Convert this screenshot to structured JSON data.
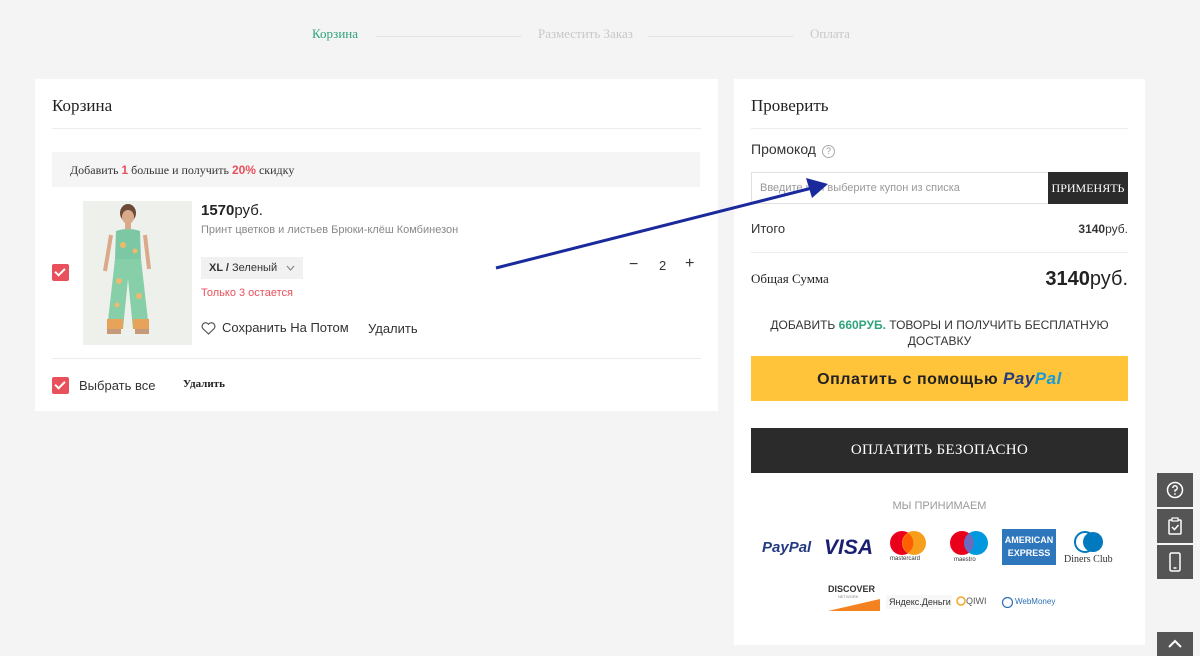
{
  "steps": {
    "cart": "Корзина",
    "place_order": "Разместить Заказ",
    "payment": "Оплата"
  },
  "cart": {
    "title": "Корзина",
    "promo_banner": {
      "prefix": "Добавить ",
      "count": "1",
      "middle": " больше и получить ",
      "discount": "20%",
      "suffix": " скидку"
    },
    "item": {
      "price": "1570",
      "currency": "руб.",
      "name": "Принт цветков и листьев Брюки-клёш Комбинезон",
      "variant_size": "XL",
      "variant_sep": " / ",
      "variant_color": "Зеленый",
      "stock": "Только 3 остается",
      "save_later": "Сохранить На Потом",
      "delete": "Удалить",
      "quantity": "2",
      "qty_minus": "−",
      "qty_plus": "+"
    },
    "select_all": "Выбрать все",
    "delete_all": "Удалить"
  },
  "checkout": {
    "title": "Проверить",
    "promo_label": "Промокод",
    "promo_help": "?",
    "promo_placeholder": "Введите или выберите купон из списка",
    "apply": "ПРИМЕНЯТЬ",
    "subtotal_label": "Итого",
    "subtotal_value": "3140",
    "subtotal_currency": "руб.",
    "total_label": "Общая Сумма",
    "total_value": "3140",
    "total_currency": "руб.",
    "free_ship": {
      "prefix": "ДОБАВИТЬ ",
      "amount": "660РУБ.",
      "suffix": " ТОВОРЫ И ПОЛУЧИТЬ БЕСПЛАТНУЮ ДОСТАВКУ"
    },
    "paypal_prefix": "Оплатить с помощью ",
    "paypal_pay": "Pay",
    "paypal_pal": "Pal",
    "secure": "ОПЛАТИТЬ БЕЗОПАСНО",
    "accept": "МЫ ПРИНИМАЕМ",
    "methods": {
      "paypal_pay": "PayPal",
      "visa": "VISA",
      "mastercard": "mastercard",
      "maestro": "maestro",
      "amex_top": "AMERICAN",
      "amex_bottom": "EXPRESS",
      "diners": "Diners Club",
      "discover": "DISCOVER",
      "discover_sub": "NETWORK",
      "yandex": "Яндекс.Деньги",
      "qiwi": "QIWI",
      "webmoney": "WebMoney"
    }
  },
  "colors": {
    "accent_green": "#2fa37c",
    "accent_red": "#e8505b",
    "paypal_yellow": "#ffc439",
    "dark_button": "#2b2b2b",
    "annotation_arrow": "#1a2a9c"
  },
  "side_tools": [
    "help-icon",
    "clipboard-check-icon",
    "mobile-icon"
  ]
}
